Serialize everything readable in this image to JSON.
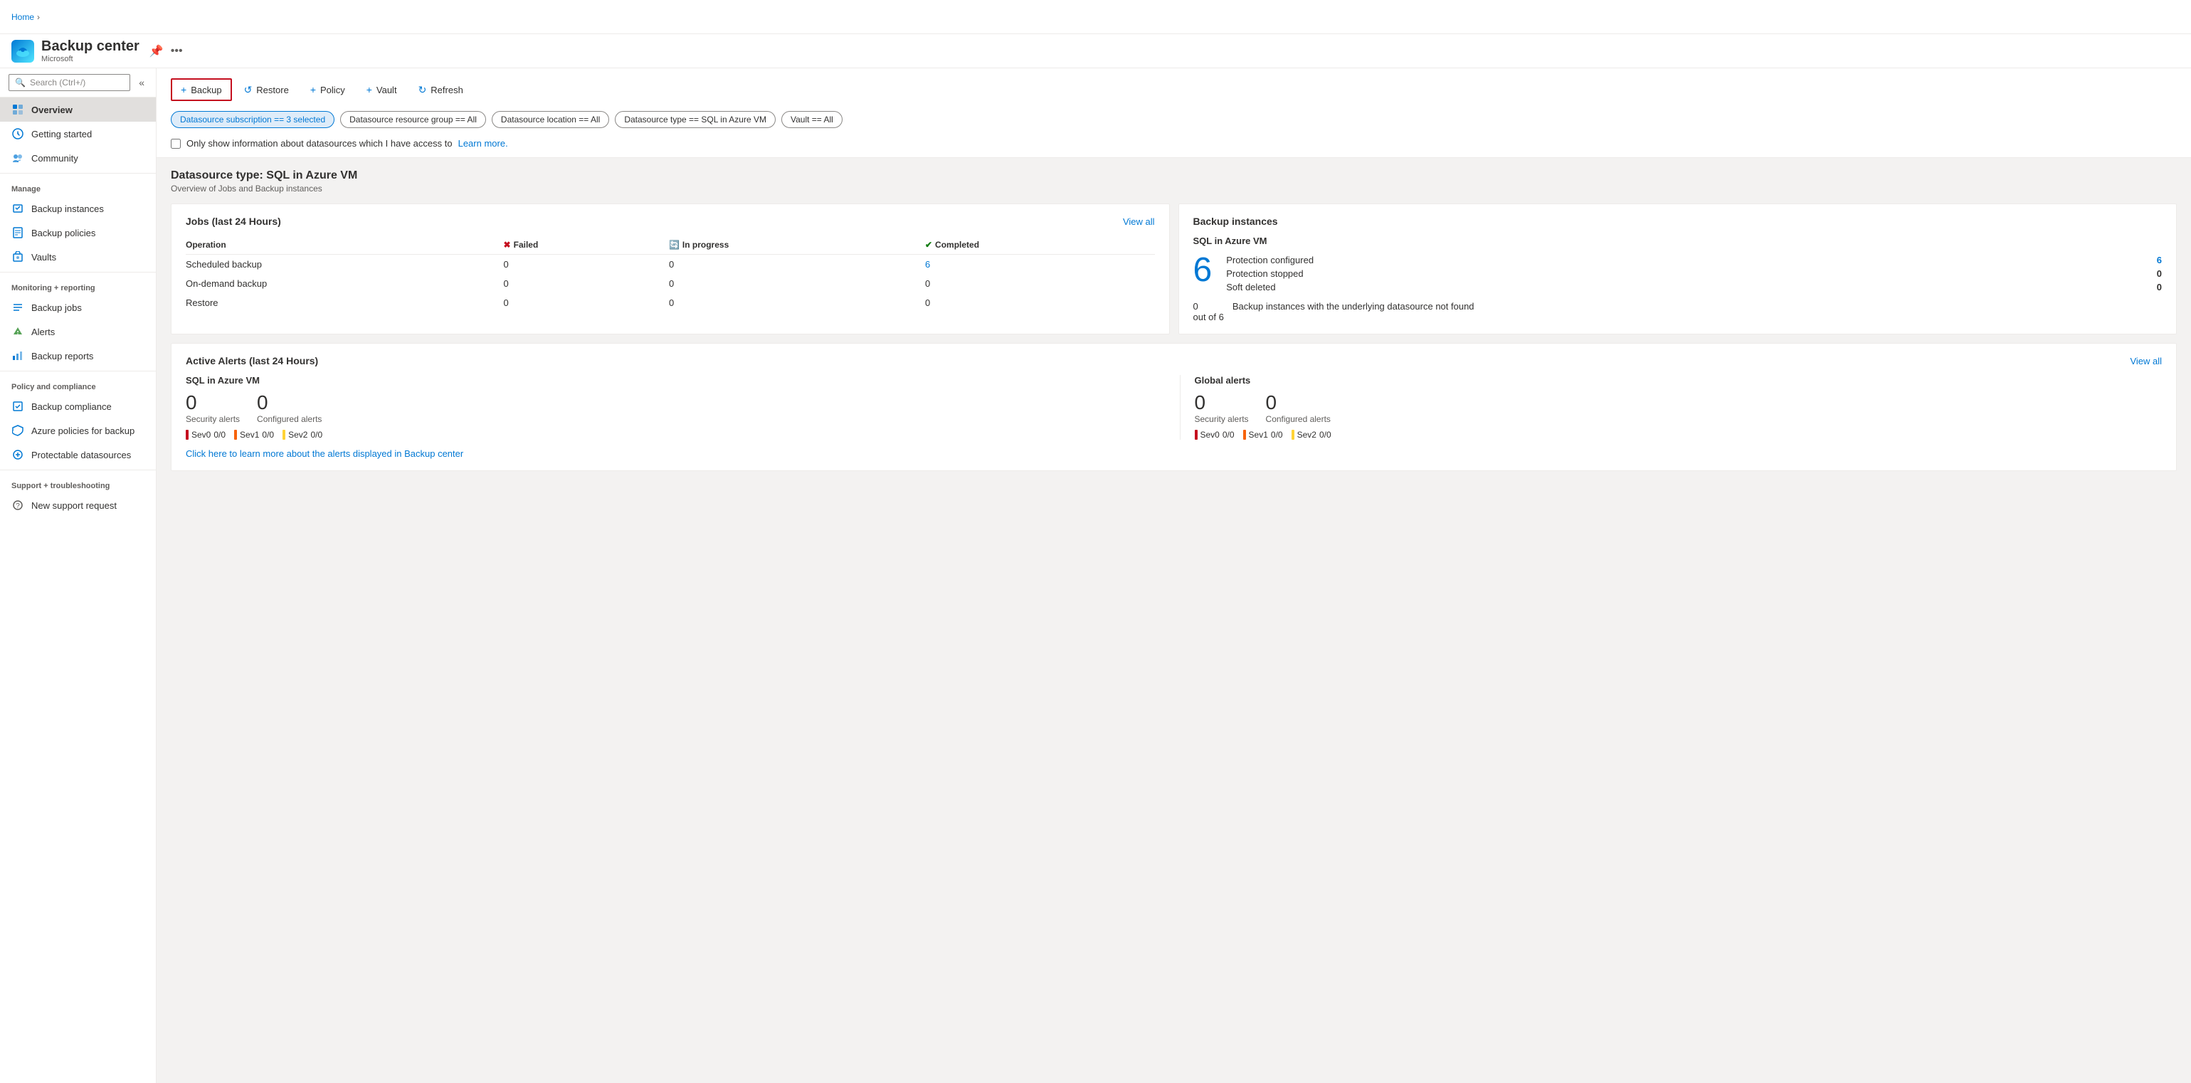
{
  "breadcrumb": {
    "items": [
      "Home"
    ]
  },
  "header": {
    "icon_label": "☁",
    "title": "Backup center",
    "subtitle": "Microsoft",
    "pin_icon": "📌",
    "ellipsis": "•••"
  },
  "sidebar": {
    "search_placeholder": "Search (Ctrl+/)",
    "collapse_label": "«",
    "items_top": [
      {
        "id": "overview",
        "label": "Overview",
        "active": true
      },
      {
        "id": "getting-started",
        "label": "Getting started",
        "active": false
      },
      {
        "id": "community",
        "label": "Community",
        "active": false
      }
    ],
    "sections": [
      {
        "label": "Manage",
        "items": [
          {
            "id": "backup-instances",
            "label": "Backup instances"
          },
          {
            "id": "backup-policies",
            "label": "Backup policies"
          },
          {
            "id": "vaults",
            "label": "Vaults"
          }
        ]
      },
      {
        "label": "Monitoring + reporting",
        "items": [
          {
            "id": "backup-jobs",
            "label": "Backup jobs"
          },
          {
            "id": "alerts",
            "label": "Alerts"
          },
          {
            "id": "backup-reports",
            "label": "Backup reports"
          }
        ]
      },
      {
        "label": "Policy and compliance",
        "items": [
          {
            "id": "backup-compliance",
            "label": "Backup compliance"
          },
          {
            "id": "azure-policies",
            "label": "Azure policies for backup"
          },
          {
            "id": "protectable-datasources",
            "label": "Protectable datasources"
          }
        ]
      },
      {
        "label": "Support + troubleshooting",
        "items": [
          {
            "id": "new-support",
            "label": "New support request"
          }
        ]
      }
    ]
  },
  "toolbar": {
    "buttons": [
      {
        "id": "backup",
        "label": "Backup",
        "icon": "+",
        "primary": true
      },
      {
        "id": "restore",
        "label": "Restore",
        "icon": "↺"
      },
      {
        "id": "policy",
        "label": "Policy",
        "icon": "+"
      },
      {
        "id": "vault",
        "label": "Vault",
        "icon": "+"
      },
      {
        "id": "refresh",
        "label": "Refresh",
        "icon": "↻"
      }
    ]
  },
  "filters": {
    "chips": [
      {
        "id": "subscription",
        "label": "Datasource subscription == 3 selected",
        "active": true
      },
      {
        "id": "resource-group",
        "label": "Datasource resource group == All",
        "active": false
      },
      {
        "id": "location",
        "label": "Datasource location == All",
        "active": false
      },
      {
        "id": "type",
        "label": "Datasource type == SQL in Azure VM",
        "active": false
      },
      {
        "id": "vault",
        "label": "Vault == All",
        "active": false
      }
    ]
  },
  "datasource_filter": {
    "checkbox_label": "Only show information about datasources which I have access to",
    "learn_more": "Learn more."
  },
  "datasource_section": {
    "title": "Datasource type: SQL in Azure VM",
    "subtitle": "Overview of Jobs and Backup instances"
  },
  "jobs_card": {
    "title": "Jobs (last 24 Hours)",
    "view_all": "View all",
    "columns": {
      "operation": "Operation",
      "failed": "Failed",
      "in_progress": "In progress",
      "completed": "Completed"
    },
    "rows": [
      {
        "operation": "Scheduled backup",
        "failed": "0",
        "in_progress": "0",
        "completed": "6",
        "completed_link": true
      },
      {
        "operation": "On-demand backup",
        "failed": "0",
        "in_progress": "0",
        "completed": "0",
        "completed_link": false
      },
      {
        "operation": "Restore",
        "failed": "0",
        "in_progress": "0",
        "completed": "0",
        "completed_link": false
      }
    ]
  },
  "backup_instances_card": {
    "title": "Backup instances",
    "datasource_label": "SQL in Azure VM",
    "total_count": "6",
    "stats": [
      {
        "label": "Protection configured",
        "value": "6",
        "link": true
      },
      {
        "label": "Protection stopped",
        "value": "0",
        "link": false
      },
      {
        "label": "Soft deleted",
        "value": "0",
        "link": false
      }
    ],
    "footer_count": "0",
    "footer_total": "out of 6",
    "footer_text": "Backup instances with the underlying datasource not found"
  },
  "alerts_card": {
    "title": "Active Alerts (last 24 Hours)",
    "view_all": "View all",
    "sections": [
      {
        "id": "sql-azure-vm",
        "title": "SQL in Azure VM",
        "security_count": "0",
        "security_label": "Security alerts",
        "configured_count": "0",
        "configured_label": "Configured alerts",
        "severities": [
          {
            "level": "Sev0",
            "value": "0/0",
            "class": "sev0"
          },
          {
            "level": "Sev1",
            "value": "0/0",
            "class": "sev1"
          },
          {
            "level": "Sev2",
            "value": "0/0",
            "class": "sev2"
          }
        ]
      },
      {
        "id": "global",
        "title": "Global alerts",
        "security_count": "0",
        "security_label": "Security alerts",
        "configured_count": "0",
        "configured_label": "Configured alerts",
        "severities": [
          {
            "level": "Sev0",
            "value": "0/0",
            "class": "sev0"
          },
          {
            "level": "Sev1",
            "value": "0/0",
            "class": "sev1"
          },
          {
            "level": "Sev2",
            "value": "0/0",
            "class": "sev2"
          }
        ]
      }
    ],
    "footer_link": "Click here to learn more about the alerts displayed in Backup center"
  }
}
